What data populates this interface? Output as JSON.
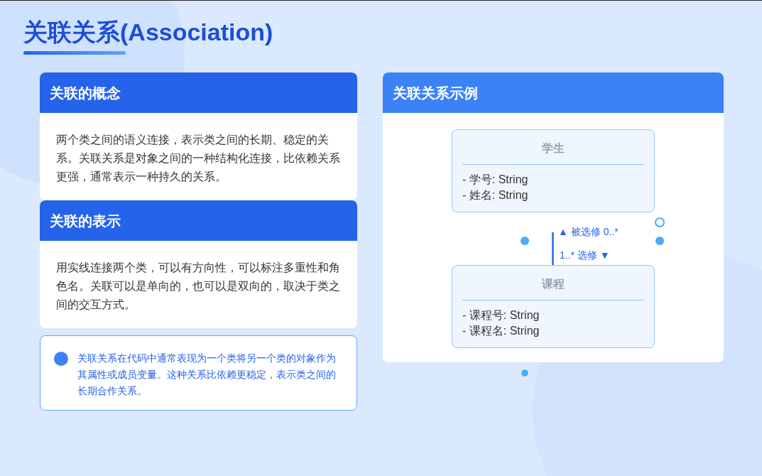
{
  "title": "关联关系(Association)",
  "left_cards": [
    {
      "title": "关联的概念",
      "body": "两个类之间的语义连接，表示类之间的长期、稳定的关系。关联关系是对象之间的一种结构化连接，比依赖关系更强，通常表示一种持久的关系。"
    },
    {
      "title": "关联的表示",
      "body": "用实线连接两个类，可以有方向性，可以标注多重性和角色名。关联可以是单向的，也可以是双向的，取决于类之间的交互方式。"
    }
  ],
  "note": {
    "text": "关联关系在代码中通常表现为一个类将另一个类的对象作为其属性或成员变量。这种关系比依赖更稳定，表示类之间的长期合作关系。"
  },
  "example": {
    "title": "关联关系示例",
    "classes": [
      {
        "name": "学生",
        "attributes": [
          "- 学号: String",
          "- 姓名: String"
        ]
      },
      {
        "name": "课程",
        "attributes": [
          "- 课程号: String",
          "- 课程名: String"
        ]
      }
    ],
    "association": {
      "upper_label": "▲ 被选修 0..*",
      "lower_label": "1..* 选修 ▼"
    }
  }
}
